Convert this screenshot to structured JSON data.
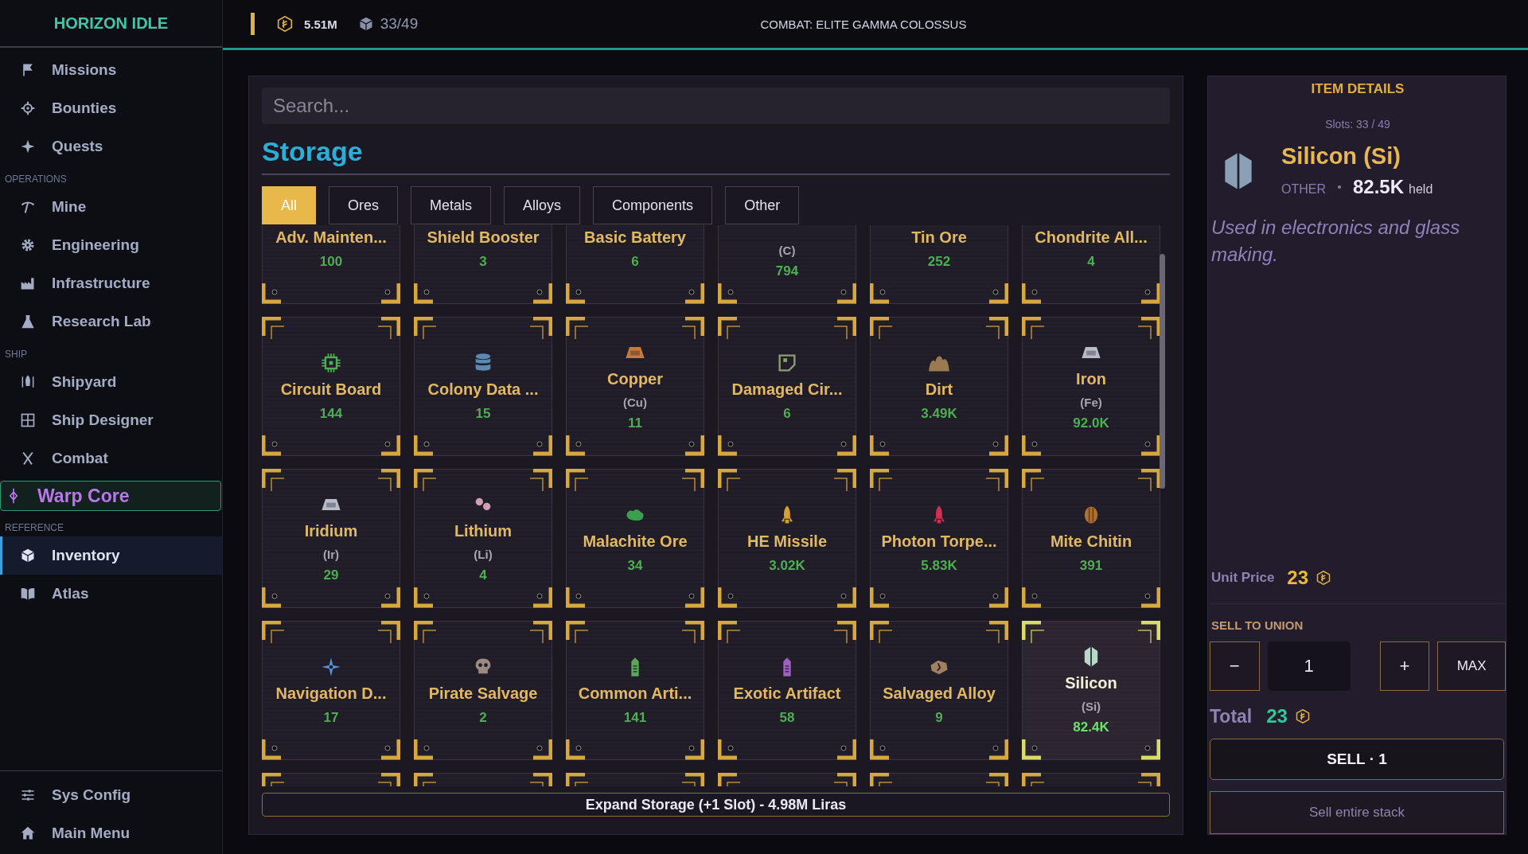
{
  "sidebar": {
    "title": "HORIZON IDLE",
    "sections": [
      {
        "items": [
          {
            "label": "Missions",
            "selected": false,
            "highlighted": false
          },
          {
            "label": "Bounties",
            "selected": false,
            "highlighted": false
          },
          {
            "label": "Quests",
            "selected": false,
            "highlighted": false
          }
        ]
      },
      {
        "heading": "OPERATIONS",
        "items": [
          {
            "label": "Mine",
            "selected": false,
            "highlighted": false
          },
          {
            "label": "Engineering",
            "selected": false,
            "highlighted": false
          },
          {
            "label": "Infrastructure",
            "selected": false,
            "highlighted": false
          },
          {
            "label": "Research Lab",
            "selected": false,
            "highlighted": false
          }
        ]
      },
      {
        "heading": "SHIP",
        "items": [
          {
            "label": "Shipyard",
            "selected": false,
            "highlighted": false
          },
          {
            "label": "Ship Designer",
            "selected": false,
            "highlighted": false
          },
          {
            "label": "Combat",
            "selected": false,
            "highlighted": false
          },
          {
            "label": "Warp Core",
            "selected": false,
            "highlighted": true
          }
        ]
      },
      {
        "heading": "REFERENCE",
        "items": [
          {
            "label": "Inventory",
            "selected": true,
            "highlighted": false
          },
          {
            "label": "Atlas",
            "selected": false,
            "highlighted": false
          }
        ]
      }
    ],
    "footer": [
      {
        "label": "Sys Config"
      },
      {
        "label": "Main Menu"
      }
    ]
  },
  "top_bar": {
    "money": "5.51M",
    "slots": "33/49",
    "status": "COMBAT: ELITE GAMMA COLOSSUS"
  },
  "storage": {
    "search": {
      "placeholder": "Search..."
    },
    "title": "Storage",
    "filters": [
      {
        "label": "All",
        "selected": true
      },
      {
        "label": "Ores",
        "selected": false
      },
      {
        "label": "Metals",
        "selected": false
      },
      {
        "label": "Alloys",
        "selected": false
      },
      {
        "label": "Components",
        "selected": false
      },
      {
        "label": "Other",
        "selected": false
      }
    ],
    "cards": [
      {
        "name": "Adv. Mainten...",
        "count": "100",
        "selected": false
      },
      {
        "name": "Shield Booster",
        "count": "3",
        "selected": false
      },
      {
        "name": "Basic Battery",
        "count": "6",
        "selected": false
      },
      {
        "symbol": "(C)",
        "count": "794",
        "selected": false
      },
      {
        "name": "Tin Ore",
        "count": "252",
        "selected": false
      },
      {
        "name": "Chondrite All...",
        "count": "4",
        "selected": false
      },
      {
        "name": "Circuit Board",
        "count": "144",
        "selected": false
      },
      {
        "name": "Colony Data ...",
        "count": "15",
        "selected": false
      },
      {
        "name": "Copper",
        "symbol": "(Cu)",
        "count": "11",
        "selected": false
      },
      {
        "name": "Damaged Cir...",
        "count": "6",
        "selected": false
      },
      {
        "name": "Dirt",
        "count": "3.49K",
        "selected": false
      },
      {
        "name": "Iron",
        "symbol": "(Fe)",
        "count": "92.0K",
        "selected": false
      },
      {
        "name": "Iridium",
        "symbol": "(Ir)",
        "count": "29",
        "selected": false
      },
      {
        "name": "Lithium",
        "symbol": "(Li)",
        "count": "4",
        "selected": false
      },
      {
        "name": "Malachite Ore",
        "count": "34",
        "selected": false
      },
      {
        "name": "HE Missile",
        "count": "3.02K",
        "selected": false
      },
      {
        "name": "Photon Torpe...",
        "count": "5.83K",
        "selected": false
      },
      {
        "name": "Mite Chitin",
        "count": "391",
        "selected": false
      },
      {
        "name": "Navigation D...",
        "count": "17",
        "selected": false
      },
      {
        "name": "Pirate Salvage",
        "count": "2",
        "selected": false
      },
      {
        "name": "Common Arti...",
        "count": "141",
        "selected": false
      },
      {
        "name": "Exotic Artifact",
        "count": "58",
        "selected": false
      },
      {
        "name": "Salvaged Alloy",
        "count": "9",
        "selected": false
      },
      {
        "name": "Silicon",
        "symbol": "(Si)",
        "count": "82.4K",
        "selected": true
      }
    ],
    "more_below": true,
    "expand_button": "Expand Storage (+1 Slot) - 4.98M Liras"
  },
  "details": {
    "heading": "ITEM DETAILS",
    "slots": "Slots: 33 / 49",
    "name": "Silicon (Si)",
    "category": "OTHER",
    "held": "82.5K",
    "held_unit": "held",
    "description": "Used in electronics and glass making.",
    "unit_price_label": "Unit Price",
    "unit_price": "23",
    "sell_heading": "SELL TO UNION",
    "minus": "−",
    "quantity": "1",
    "plus": "+",
    "max": "MAX",
    "total_label": "Total",
    "total": "23",
    "sell_button": "SELL · 1",
    "sell_stack_button": "Sell entire stack"
  }
}
